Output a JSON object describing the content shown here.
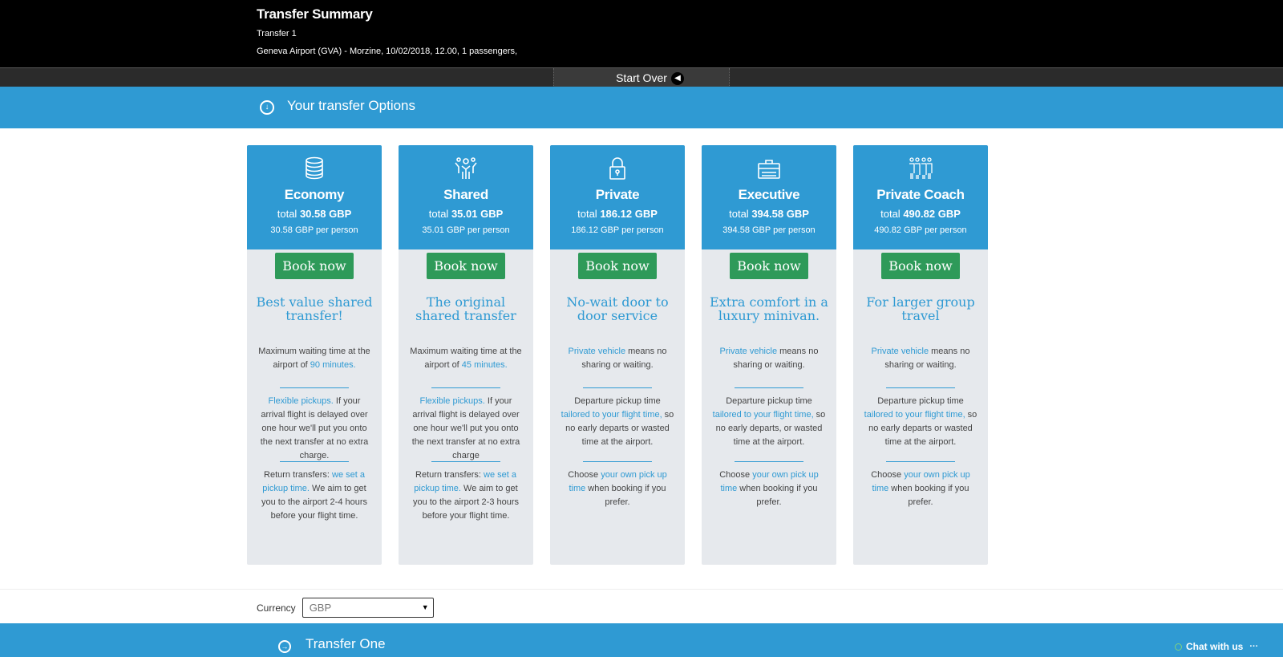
{
  "summary": {
    "title": "Transfer Summary",
    "transfer_label": "Transfer 1",
    "details": "Geneva Airport (GVA) - Morzine,  10/02/2018,  12.00,  1 passengers,"
  },
  "start_over": "Start Over",
  "options_title": "Your transfer Options",
  "cards": [
    {
      "icon": "coins-icon",
      "name": "Economy",
      "total_prefix": "total",
      "total": "30.58 GBP",
      "per_person": "30.58 GBP per person",
      "book": "Book now",
      "tagline": "Best value shared transfer!",
      "p1a": "Maximum waiting time at the airport of ",
      "p1b": "90 minutes.",
      "p2a": "Flexible pickups.",
      "p2b": " If your arrival flight is delayed over one hour we'll put you onto the next transfer at no extra charge.",
      "p3a": "Return transfers: ",
      "p3b": "we set a pickup time.",
      "p3c": " We aim to get you to the airport 2-4 hours before your flight time."
    },
    {
      "icon": "people-icon",
      "name": "Shared",
      "total_prefix": "total",
      "total": "35.01 GBP",
      "per_person": "35.01 GBP per person",
      "book": "Book now",
      "tagline": "The original shared transfer",
      "p1a": "Maximum waiting time at the airport of ",
      "p1b": "45 minutes.",
      "p2a": "Flexible pickups.",
      "p2b": " If your arrival flight is delayed over one hour we'll put you onto the next transfer at no extra charge",
      "p3a": "Return transfers: ",
      "p3b": "we set a pickup time.",
      "p3c": " We aim to get you to the airport 2-3 hours before your flight time."
    },
    {
      "icon": "lock-icon",
      "name": "Private",
      "total_prefix": "total",
      "total": "186.12 GBP",
      "per_person": "186.12 GBP per person",
      "book": "Book now",
      "tagline": "No-wait door to door service",
      "p1a": "Private vehicle",
      "p1b": " means no sharing or waiting.",
      "p2a": "Departure pickup time ",
      "p2b": "tailored to your flight time,",
      "p2c": " so no early departs or wasted time at the airport.",
      "p3a": "Choose ",
      "p3b": "your own pick up time",
      "p3c": " when booking if you prefer."
    },
    {
      "icon": "briefcase-icon",
      "name": "Executive",
      "total_prefix": "total",
      "total": "394.58 GBP",
      "per_person": "394.58 GBP per person",
      "book": "Book now",
      "tagline": "Extra comfort in a luxury minivan.",
      "p1a": "Private vehicle",
      "p1b": " means no sharing or waiting.",
      "p2a": "Departure pickup time ",
      "p2b": "tailored to your flight time,",
      "p2c": " so no early departs, or wasted time at the airport.",
      "p3a": "Choose ",
      "p3b": "your own pick up time",
      "p3c": " when booking if you prefer."
    },
    {
      "icon": "group-icon",
      "name": "Private Coach",
      "total_prefix": "total",
      "total": "490.82 GBP",
      "per_person": "490.82 GBP per person",
      "book": "Book now",
      "tagline": "For larger group travel",
      "p1a": "Private vehicle",
      "p1b": " means no sharing or waiting.",
      "p2a": "Departure pickup time ",
      "p2b": "tailored to your flight time,",
      "p2c": " so no early departs or wasted time at the airport.",
      "p3a": "Choose ",
      "p3b": "your own pick up time",
      "p3c": " when booking if you prefer."
    }
  ],
  "currency": {
    "label": "Currency",
    "value": "GBP"
  },
  "transfer_one_title": "Transfer One",
  "chat": {
    "label": "Chat with us",
    "more": "···"
  },
  "colors": {
    "accent": "#2f9ad3",
    "book_green": "#2e9a59",
    "card_bg": "#e6e9ed"
  }
}
